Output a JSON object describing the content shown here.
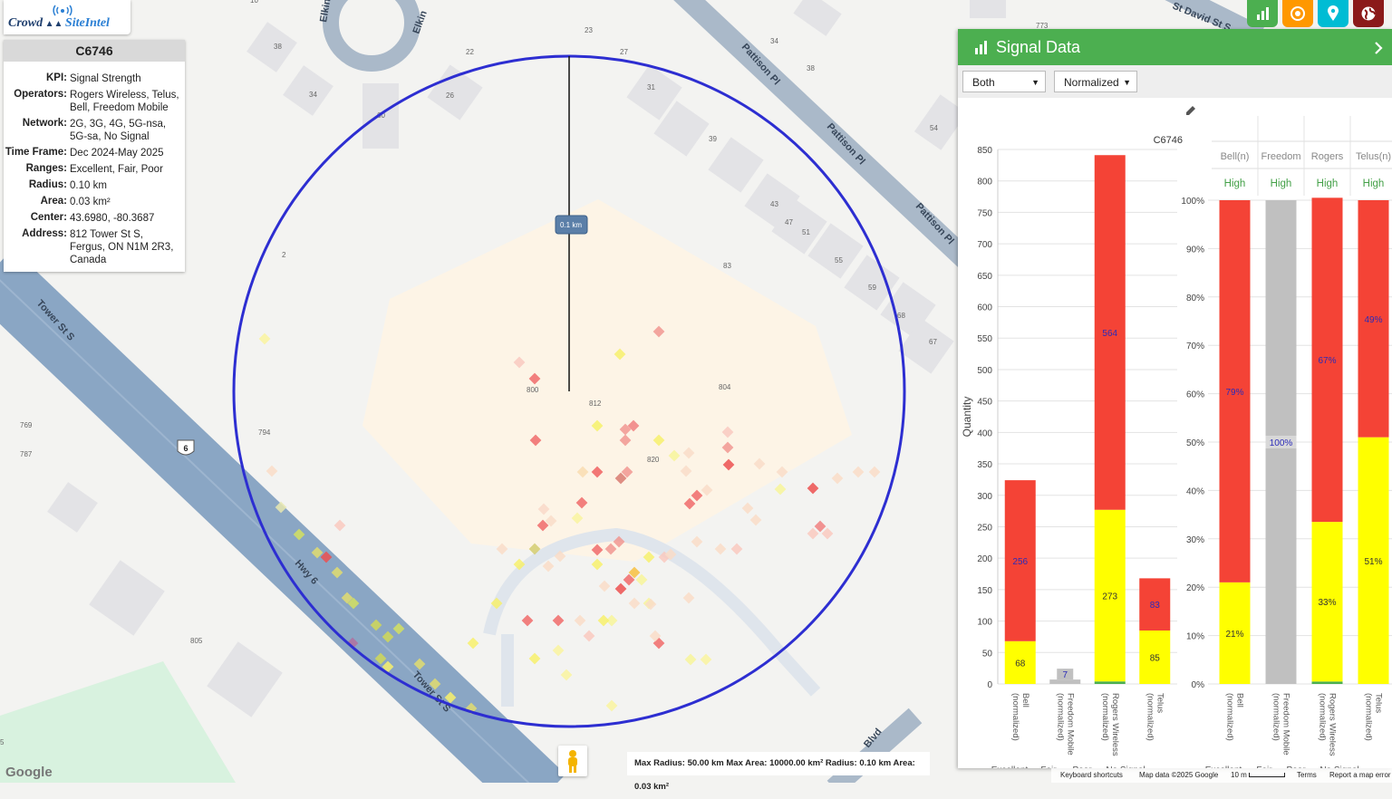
{
  "app": {
    "logo_crowd": "Crowd",
    "logo_rest": "SiteIntel"
  },
  "info_panel": {
    "title": "C6746",
    "rows": [
      {
        "key": "KPI:",
        "value": "Signal Strength"
      },
      {
        "key": "Operators:",
        "value": "Rogers Wireless, Telus, Bell, Freedom Mobile"
      },
      {
        "key": "Network:",
        "value": "2G, 3G, 4G, 5G-nsa, 5G-sa, No Signal"
      },
      {
        "key": "Time Frame:",
        "value": "Dec 2024-May 2025"
      },
      {
        "key": "Ranges:",
        "value": "Excellent, Fair, Poor"
      },
      {
        "key": "Radius:",
        "value": "0.10 km"
      },
      {
        "key": "Area:",
        "value": "0.03 km²"
      },
      {
        "key": "Center:",
        "value": "43.6980, -80.3687"
      },
      {
        "key": "Address:",
        "value": "812 Tower St S, Fergus, ON N1M 2R3, Canada"
      }
    ]
  },
  "top_controls": [
    {
      "icon": "bar-chart-icon",
      "color": "#4caf50"
    },
    {
      "icon": "target-icon",
      "color": "#ff9800"
    },
    {
      "icon": "location-pin-icon",
      "color": "#00bcd4"
    },
    {
      "icon": "globe-icon",
      "color": "#8b1a1a"
    }
  ],
  "map": {
    "streets": [
      "Tower St S",
      "Hwy 6",
      "Tower St S",
      "Pattison Pl",
      "Pattison Pl",
      "Pattison Pl",
      "St David St S",
      "Elkin",
      "Elkin",
      "Blvd"
    ],
    "route_shield": "6",
    "house_numbers": [
      "23",
      "22",
      "27",
      "34",
      "38",
      "31",
      "26",
      "38",
      "34",
      "39",
      "54",
      "43",
      "47",
      "51",
      "55",
      "59",
      "68",
      "67",
      "83",
      "2",
      "800",
      "812",
      "804",
      "794",
      "820",
      "769",
      "787",
      "805",
      "773",
      "10",
      "60",
      "5"
    ],
    "radius_label": "0.1 km",
    "radius_km": 0.1
  },
  "signal_panel": {
    "title": "Signal Data",
    "dropdown_mode": "Both",
    "dropdown_scale": "Normalized",
    "chart_name": "C6746",
    "expand_icon": "chevron-right-icon"
  },
  "chart_data": [
    {
      "type": "bar",
      "stacked": true,
      "categories": [
        "Bell (normalized)",
        "Freedom Mobile (normalized)",
        "Rogers Wireless (normalized)",
        "Telus (normalized)"
      ],
      "series": [
        {
          "name": "Excellent",
          "color": "#4caf50",
          "values": [
            0,
            0,
            4,
            0
          ]
        },
        {
          "name": "Fair",
          "color": "#ffff00",
          "values": [
            68,
            0,
            273,
            85
          ]
        },
        {
          "name": "Poor",
          "color": "#f44336",
          "values": [
            256,
            0,
            564,
            83
          ]
        },
        {
          "name": "No Signal",
          "color": "#c0c0c0",
          "values": [
            0,
            7,
            0,
            0
          ]
        }
      ],
      "labels": [
        [
          "",
          "68",
          "256",
          ""
        ],
        [
          "",
          "",
          "",
          "7"
        ],
        [
          "",
          "273",
          "564",
          ""
        ],
        [
          "",
          "85",
          "83",
          ""
        ]
      ],
      "ylabel": "Quantity",
      "ylim": [
        0,
        850
      ],
      "yticks": [
        0,
        50,
        100,
        150,
        200,
        250,
        300,
        350,
        400,
        450,
        500,
        550,
        600,
        650,
        700,
        750,
        800,
        850
      ],
      "legend": "bottom"
    },
    {
      "type": "bar",
      "stacked": true,
      "percent": true,
      "categories": [
        "Bell (normalized)",
        "Freedom Mobile (normalized)",
        "Rogers Wireless (normalized)",
        "Telus (normalized)"
      ],
      "headers": [
        "Bell(n)",
        "Freedom",
        "Rogers",
        "Telus(n)"
      ],
      "header_values": [
        "High",
        "High",
        "High",
        "High"
      ],
      "series": [
        {
          "name": "Excellent",
          "color": "#4caf50",
          "values": [
            0,
            0,
            0.5,
            0
          ]
        },
        {
          "name": "Fair",
          "color": "#ffff00",
          "values": [
            21,
            0,
            33,
            51
          ]
        },
        {
          "name": "Poor",
          "color": "#f44336",
          "values": [
            79,
            0,
            67,
            49
          ]
        },
        {
          "name": "No Signal",
          "color": "#c0c0c0",
          "values": [
            0,
            100,
            0,
            0
          ]
        }
      ],
      "labels": [
        [
          "",
          "21%",
          "79%",
          ""
        ],
        [
          "",
          "",
          "",
          "100%"
        ],
        [
          "",
          "33%",
          "67%",
          ""
        ],
        [
          "",
          "51%",
          "49%",
          ""
        ]
      ],
      "ylim": [
        0,
        100
      ],
      "yticks": [
        "0%",
        "10%",
        "20%",
        "30%",
        "40%",
        "50%",
        "60%",
        "70%",
        "80%",
        "90%",
        "100%"
      ],
      "legend": "bottom"
    }
  ],
  "footer": {
    "radius_info": "Max Radius: 50.00 km  Max Area: 10000.00 km²  Radius: 0.10 km  Area: 0.03 km²",
    "keyboard": "Keyboard shortcuts",
    "map_data": "Map data ©2025 Google",
    "scale": "10 m",
    "terms": "Terms",
    "report": "Report a map error",
    "google": "Google"
  }
}
